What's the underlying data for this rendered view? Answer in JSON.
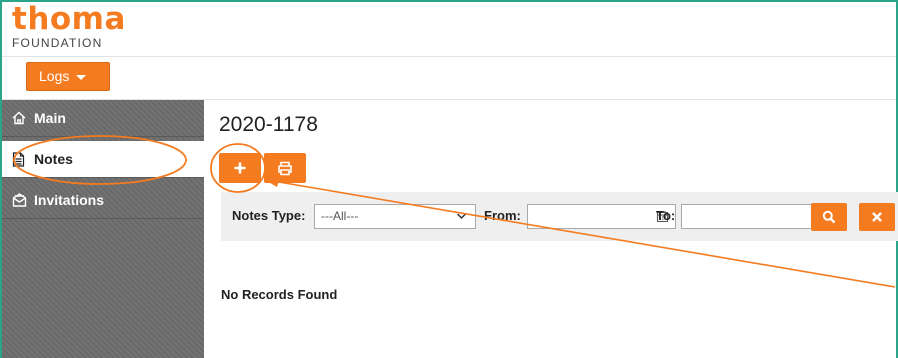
{
  "brand": {
    "name": "thoma",
    "subtitle": "FOUNDATION",
    "accent": "#f47b20"
  },
  "toolbar": {
    "logs_label": "Logs"
  },
  "sidebar": {
    "items": [
      {
        "label": "Main",
        "icon": "home-icon"
      },
      {
        "label": "Notes",
        "icon": "document-icon",
        "active": true
      },
      {
        "label": "Invitations",
        "icon": "envelope-icon"
      }
    ]
  },
  "main": {
    "title": "2020-1178",
    "actions": [
      {
        "icon": "plus-icon"
      },
      {
        "icon": "print-icon"
      }
    ],
    "filters": {
      "notes_type_label": "Notes Type:",
      "notes_type_value": "---All---",
      "from_label": "From:",
      "from_value": "",
      "to_label": "To:",
      "to_value": "",
      "search_icon": "search-icon",
      "clear_icon": "close-icon"
    },
    "empty_message": "No Records Found"
  },
  "annotations": {
    "color": "#f47b20"
  }
}
